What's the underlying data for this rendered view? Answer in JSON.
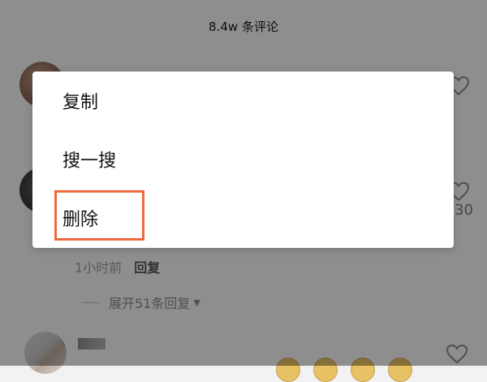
{
  "sheet": {
    "title": "8.4w 条评论"
  },
  "comments": [
    {
      "like_count": ""
    },
    {
      "like_count": "30",
      "time": "1小时前",
      "reply_label": "回复",
      "expand_label": "展开51条回复"
    },
    {
      "like_count": ""
    }
  ],
  "context_menu": {
    "items": [
      {
        "label": "复制"
      },
      {
        "label": "搜一搜"
      },
      {
        "label": "删除"
      }
    ],
    "highlighted_item": "删除",
    "highlight_color": "#ee6a3e"
  },
  "icons": {
    "like": "heart-icon",
    "expand": "caret-down-icon"
  }
}
